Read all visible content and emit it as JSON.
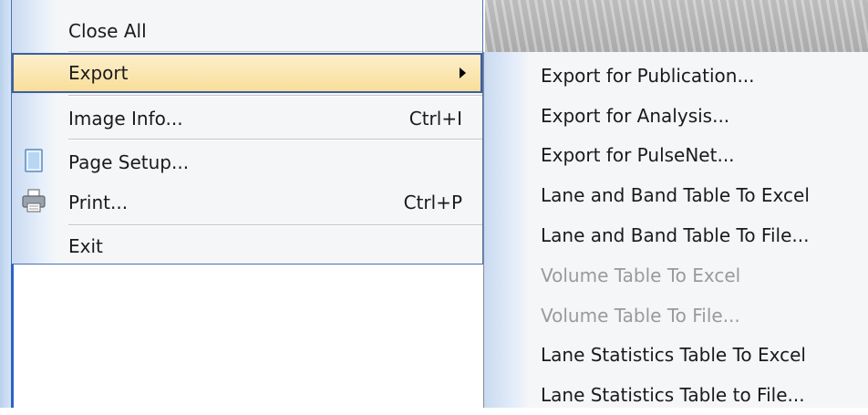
{
  "file_menu": {
    "items": [
      {
        "label": "Close All",
        "shortcut": ""
      },
      {
        "label": "Export",
        "shortcut": ""
      },
      {
        "label": "Image Info...",
        "shortcut": "Ctrl+I"
      },
      {
        "label": "Page Setup...",
        "shortcut": ""
      },
      {
        "label": "Print...",
        "shortcut": "Ctrl+P"
      },
      {
        "label": "Exit",
        "shortcut": ""
      }
    ]
  },
  "export_submenu": {
    "items": [
      {
        "label": "Export for Publication...",
        "enabled": true
      },
      {
        "label": "Export for Analysis...",
        "enabled": true
      },
      {
        "label": "Export for PulseNet...",
        "enabled": true
      },
      {
        "label": "Lane and Band Table To Excel",
        "enabled": true
      },
      {
        "label": "Lane and Band Table To File...",
        "enabled": true
      },
      {
        "label": "Volume Table To Excel",
        "enabled": false
      },
      {
        "label": "Volume Table To File...",
        "enabled": false
      },
      {
        "label": "Lane Statistics Table To Excel",
        "enabled": true
      },
      {
        "label": "Lane Statistics Table to File...",
        "enabled": true
      }
    ]
  },
  "icons": {
    "page_setup": "page-setup-icon",
    "print": "printer-icon",
    "submenu_arrow": "submenu-arrow-icon"
  },
  "colors": {
    "highlight": "#f8dd97",
    "highlight_border": "#3c5f9e",
    "menu_border": "#4a6fb5",
    "disabled_text": "#9a9a9a"
  }
}
